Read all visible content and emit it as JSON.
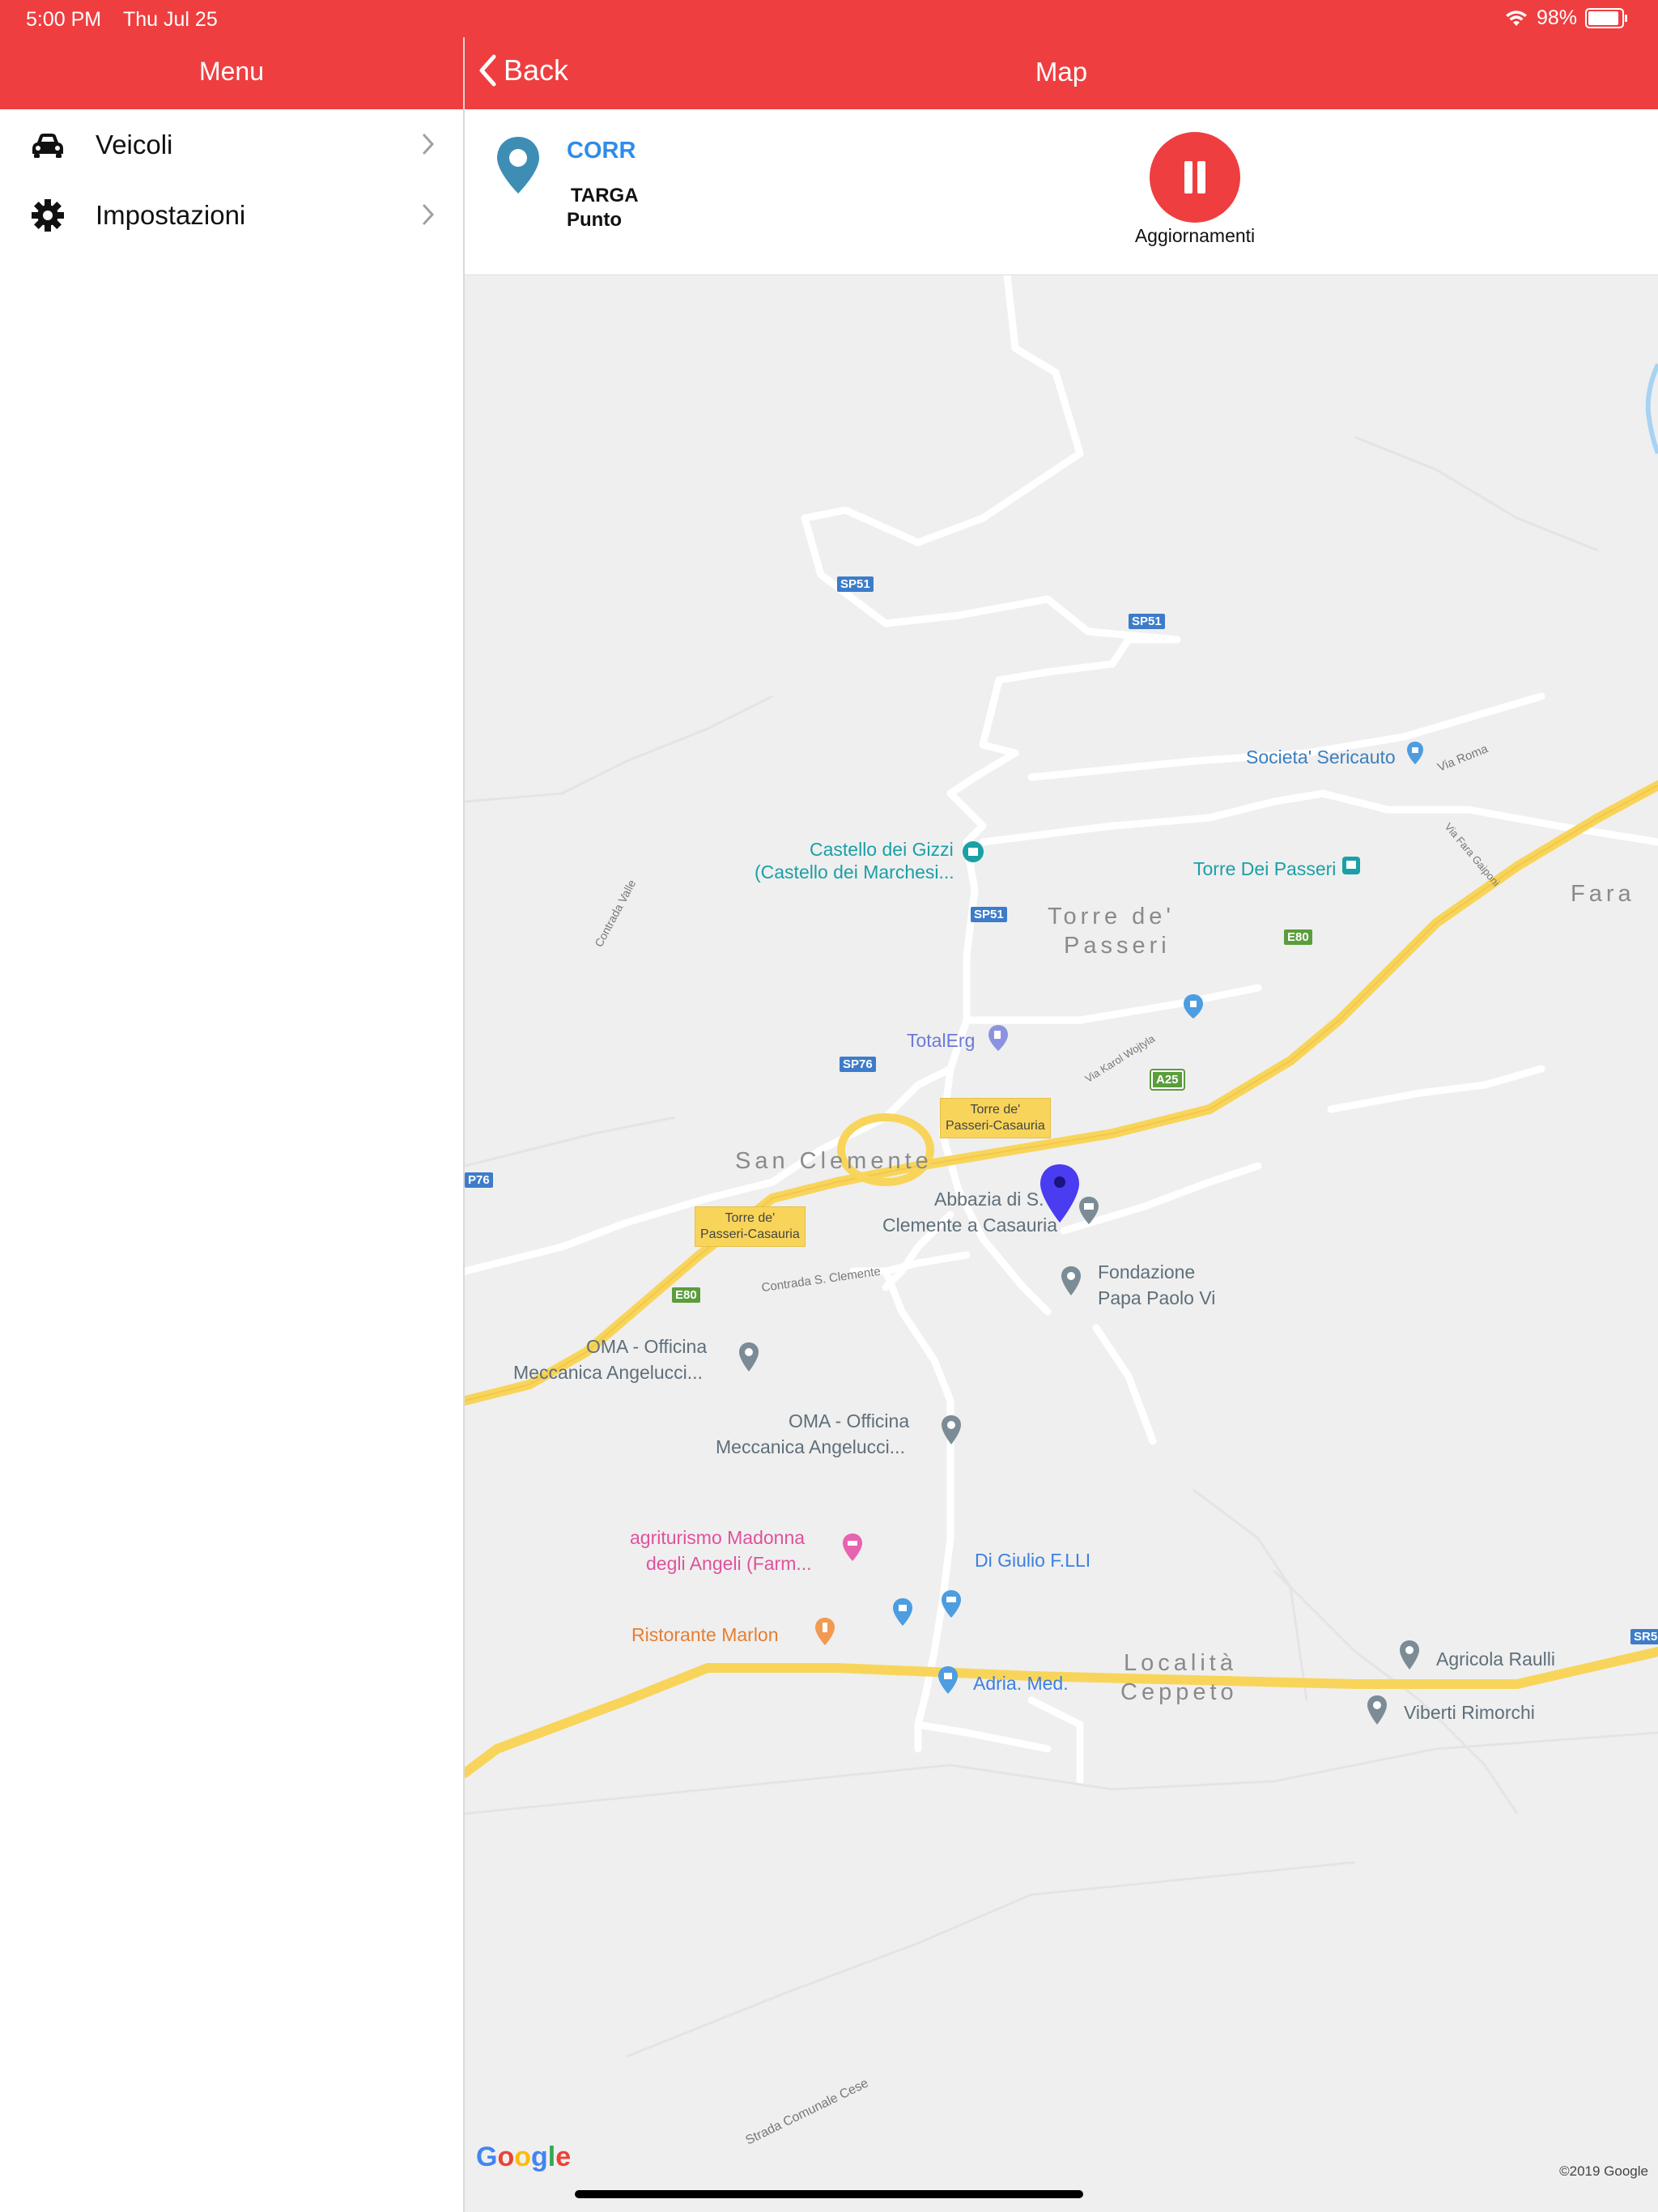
{
  "status_bar": {
    "time": "5:00 PM",
    "date": "Thu Jul 25",
    "battery": "98%"
  },
  "sidebar": {
    "title": "Menu",
    "items": [
      {
        "label": "Veicoli",
        "icon": "car-icon"
      },
      {
        "label": "Impostazioni",
        "icon": "gear-icon"
      }
    ]
  },
  "header": {
    "back_label": "Back",
    "title": "Map"
  },
  "info": {
    "name": "CORR",
    "targa": "TARGA",
    "punto": "Punto",
    "pause_label": "Aggiornamenti"
  },
  "map": {
    "towns": [
      "Torre de'",
      "Passeri",
      "San Clemente",
      "Fara",
      "Località",
      "Ceppeto"
    ],
    "pois": [
      "Societa' Sericauto",
      "Castello dei Gizzi",
      "(Castello dei Marchesi...",
      "Torre Dei Passeri",
      "TotalErg",
      "Abbazia di S.",
      "Clemente a Casauria",
      "Fondazione",
      "Papa Paolo Vi",
      "OMA - Officina",
      "Meccanica Angelucci...",
      "agriturismo Madonna",
      "degli Angeli (Farm...",
      "Ristorante Marlon",
      "Di Giulio F.LLI",
      "Adria. Med.",
      "Agricola Raulli",
      "Viberti Rimorchi"
    ],
    "roads": [
      "Via Roma",
      "Via Fara Gaiponi",
      "Contrada Valle",
      "Via Karol Wojtyla",
      "Contrada S. Clemente",
      "Strada Comunale Cese"
    ],
    "shields": [
      "SP51",
      "SP76",
      "E80",
      "A25",
      "P76",
      "SR5"
    ],
    "junctions": [
      {
        "line1": "Torre de'",
        "line2": "Passeri-Casauria"
      }
    ],
    "attribution": "Google",
    "copyright": "©2019 Google"
  },
  "colors": {
    "accent": "#ef3e40",
    "link": "#2f8ce8",
    "highway": "#f8d55a",
    "marker": "#4a3cf0"
  }
}
